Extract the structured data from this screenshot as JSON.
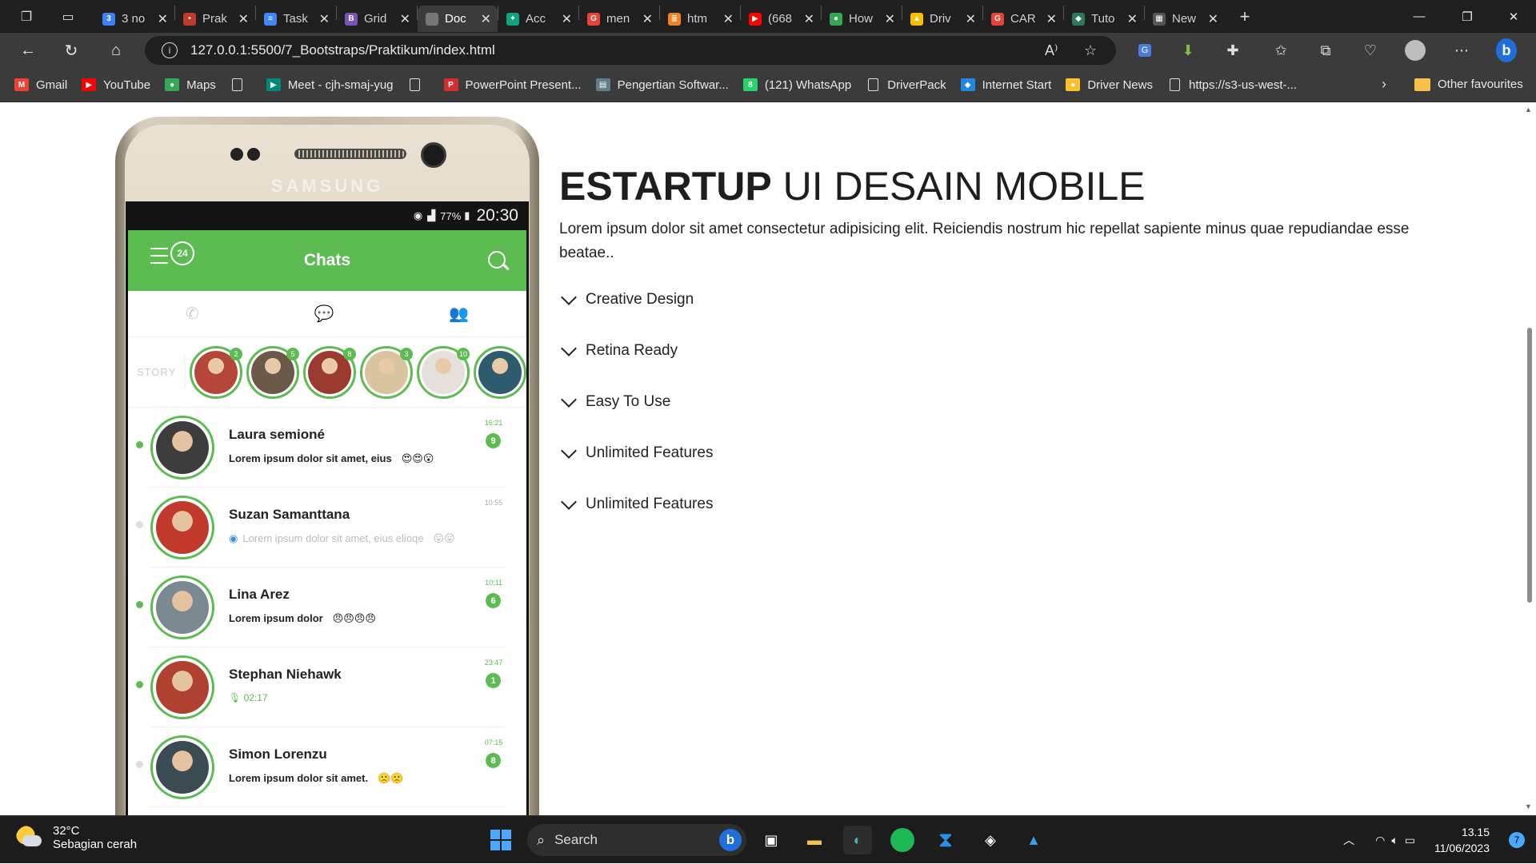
{
  "tabs": [
    {
      "title": "3 no",
      "icon": "badge-icon",
      "color": "#3b82f6",
      "glyph": "3"
    },
    {
      "title": "Prak",
      "icon": "dot-icon",
      "color": "#c0392b",
      "glyph": "•"
    },
    {
      "title": "Task",
      "icon": "docs-icon",
      "color": "#4285f4",
      "glyph": "≡"
    },
    {
      "title": "Grid",
      "icon": "bootstrap-icon",
      "color": "#7952b3",
      "glyph": "B"
    },
    {
      "title": "Doc",
      "icon": "page-icon",
      "color": "#777",
      "glyph": ""
    },
    {
      "title": "Acc",
      "icon": "openai-icon",
      "color": "#10a37f",
      "glyph": "✦"
    },
    {
      "title": "men",
      "icon": "google-icon",
      "color": "#ea4335",
      "glyph": "G"
    },
    {
      "title": "htm",
      "icon": "stack-icon",
      "color": "#f48024",
      "glyph": "≣"
    },
    {
      "title": "(668",
      "icon": "youtube-icon",
      "color": "#ff0000",
      "glyph": "▶"
    },
    {
      "title": "How",
      "icon": "round-icon",
      "color": "#34a853",
      "glyph": "●"
    },
    {
      "title": "Driv",
      "icon": "drive-icon",
      "color": "#fbbc04",
      "glyph": "▲"
    },
    {
      "title": "CAR",
      "icon": "google-icon",
      "color": "#ea4335",
      "glyph": "G"
    },
    {
      "title": "Tuto",
      "icon": "leaf-icon",
      "color": "#2c7a5c",
      "glyph": "◆"
    },
    {
      "title": "New",
      "icon": "newtab-icon",
      "color": "#555",
      "glyph": "▦"
    }
  ],
  "active_tab": 4,
  "address": {
    "url": "127.0.0.1:5500/7_Bootstraps/Praktikum/index.html"
  },
  "bookmarks": [
    {
      "label": "Gmail",
      "icon": "gmail-icon",
      "color": "#ea4335",
      "glyph": "M"
    },
    {
      "label": "YouTube",
      "icon": "youtube-icon",
      "color": "#ff0000",
      "glyph": "▶"
    },
    {
      "label": "Maps",
      "icon": "maps-icon",
      "color": "#34a853",
      "glyph": "●"
    },
    {
      "label": "",
      "icon": "doc-icon",
      "color": "",
      "glyph": ""
    },
    {
      "label": "Meet - cjh-smaj-yug",
      "icon": "meet-icon",
      "color": "#00897b",
      "glyph": "▶"
    },
    {
      "label": "",
      "icon": "doc-icon",
      "color": "",
      "glyph": ""
    },
    {
      "label": "PowerPoint Present...",
      "icon": "pdf-icon",
      "color": "#d32f2f",
      "glyph": "P"
    },
    {
      "label": "Pengertian Softwar...",
      "icon": "site-icon",
      "color": "#607d8b",
      "glyph": "▤"
    },
    {
      "label": "(121) WhatsApp",
      "icon": "whatsapp-icon",
      "color": "#25d366",
      "glyph": "8"
    },
    {
      "label": "DriverPack",
      "icon": "doc-icon",
      "color": "",
      "glyph": ""
    },
    {
      "label": "Internet Start",
      "icon": "msn-icon",
      "color": "#1e88e5",
      "glyph": "◆"
    },
    {
      "label": "Driver News",
      "icon": "chrome-icon",
      "color": "#fbc02d",
      "glyph": "●"
    },
    {
      "label": "https://s3-us-west-...",
      "icon": "doc-icon",
      "color": "",
      "glyph": ""
    },
    {
      "label": "Other favourites",
      "icon": "folder-icon",
      "color": "#f6c14b",
      "glyph": ""
    }
  ],
  "phone": {
    "brand": "SAMSUNG",
    "battery": "77%",
    "clock": "20:30",
    "header_title": "Chats",
    "menu_badge": "24",
    "story_label": "STORY",
    "stories": [
      {
        "count": "2",
        "color": "#b5473a"
      },
      {
        "count": "5",
        "color": "#6b5a4a"
      },
      {
        "count": "8",
        "color": "#9b3a30"
      },
      {
        "count": "3",
        "color": "#d8c4a0"
      },
      {
        "count": "10",
        "color": "#e6e0dc"
      },
      {
        "count": "",
        "color": "#2e5b6e"
      }
    ],
    "chats": [
      {
        "name": "Laura semioné",
        "message": "Lorem ipsum dolor sit amet, eius",
        "emoji": "😍😍😮",
        "time": "16:21",
        "count": "9",
        "online": true,
        "muted": false,
        "color": "#3d3d3d"
      },
      {
        "name": "Suzan Samanttana",
        "message": "Lorem ipsum dolor sit amet, eius elioqe",
        "emoji": "😛😛",
        "time": "10:55",
        "count": "",
        "online": false,
        "muted": true,
        "color": "#c0392b"
      },
      {
        "name": "Lina Arez",
        "message": "Lorem ipsum dolor",
        "emoji": "😠😠😠😠",
        "time": "10:11",
        "count": "6",
        "online": true,
        "muted": false,
        "color": "#7a8a90"
      },
      {
        "name": "Stephan Niehawk",
        "message": "02:17",
        "emoji": "",
        "time": "23:47",
        "count": "1",
        "online": true,
        "muted": false,
        "voice": true,
        "color": "#b04030"
      },
      {
        "name": "Simon Lorenzu",
        "message": "Lorem ipsum dolor sit amet.",
        "emoji": "🙁🙁",
        "time": "07:15",
        "count": "8",
        "online": false,
        "muted": false,
        "color": "#3a4b52"
      }
    ]
  },
  "hero": {
    "title_bold": "ESTARTUP",
    "title_light": " UI DESAIN MOBILE",
    "description": "Lorem ipsum dolor sit amet consectetur adipisicing elit. Reiciendis nostrum hic repellat sapiente minus quae repudiandae esse beatae..",
    "accordion": [
      "Creative Design",
      "Retina Ready",
      "Easy To Use",
      "Unlimited Features",
      "Unlimited Features"
    ]
  },
  "taskbar": {
    "temp": "32°C",
    "weather": "Sebagian cerah",
    "search": "Search",
    "time": "13.15",
    "date": "11/06/2023",
    "notif": "7"
  },
  "colors": {
    "accent": "#5cbc52",
    "chrome_dark": "#1f1f1f",
    "chrome_mid": "#3b3b3b"
  }
}
